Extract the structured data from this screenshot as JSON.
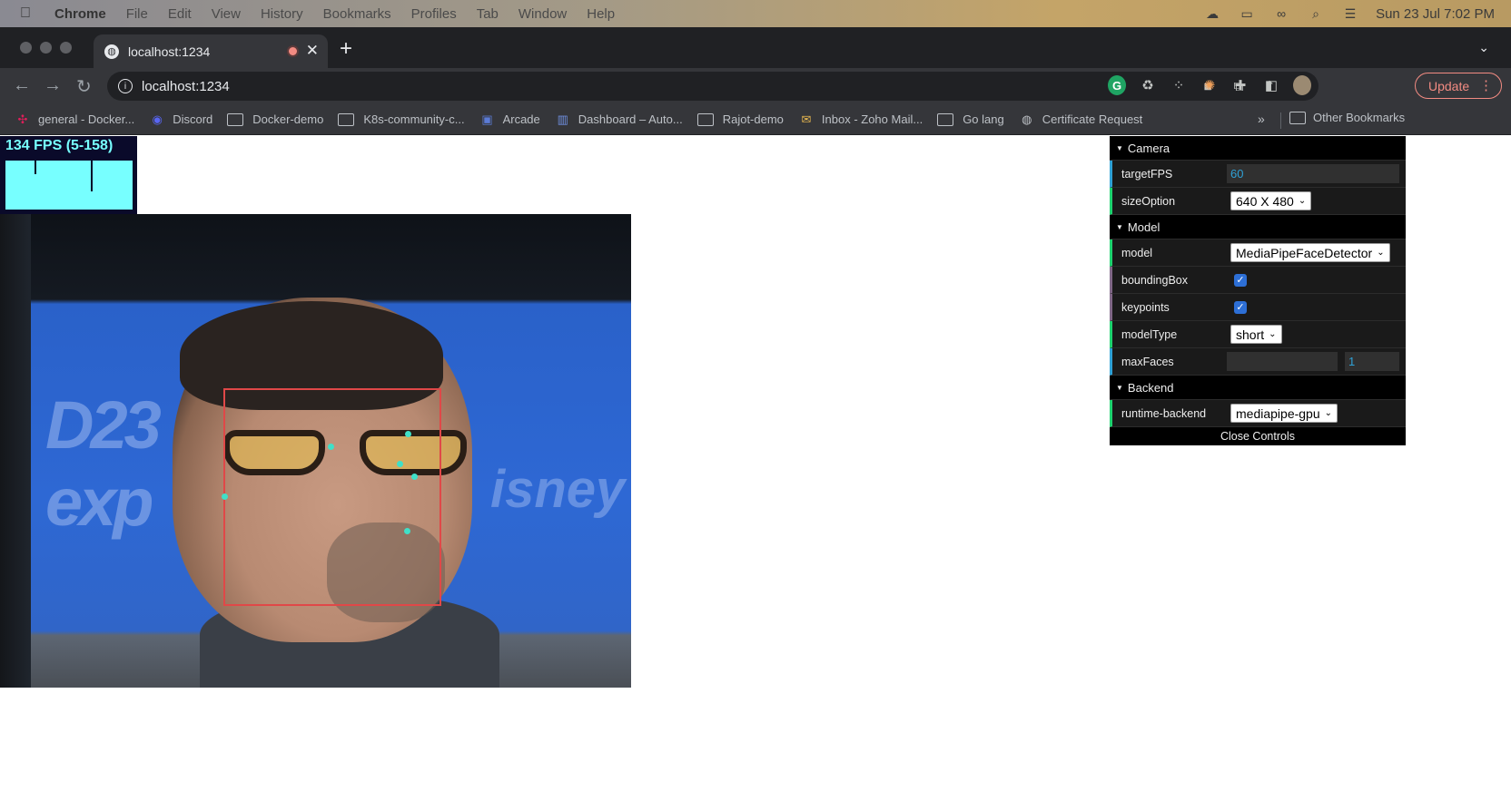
{
  "menubar": {
    "apple": "",
    "items": [
      "Chrome",
      "File",
      "Edit",
      "View",
      "History",
      "Bookmarks",
      "Profiles",
      "Tab",
      "Window",
      "Help"
    ],
    "datetime": "Sun 23 Jul  7:02 PM"
  },
  "tab": {
    "title": "localhost:1234"
  },
  "toolbar": {
    "url": "localhost:1234",
    "update_label": "Update"
  },
  "bookmarks": {
    "items": [
      "general - Docker...",
      "Discord",
      "Docker-demo",
      "K8s-community-c...",
      "Arcade",
      "Dashboard – Auto...",
      "Rajot-demo",
      "Inbox - Zoho Mail...",
      "Go lang",
      "Certificate Request"
    ],
    "overflow": "»",
    "other": "Other Bookmarks"
  },
  "stats": {
    "fps_text": "134 FPS (5-158)"
  },
  "controls": {
    "camera": {
      "title": "Camera",
      "targetFPS_label": "targetFPS",
      "targetFPS_value": "60",
      "sizeOption_label": "sizeOption",
      "sizeOption_value": "640 X 480"
    },
    "model": {
      "title": "Model",
      "model_label": "model",
      "model_value": "MediaPipeFaceDetector",
      "boundingBox_label": "boundingBox",
      "boundingBox_checked": true,
      "keypoints_label": "keypoints",
      "keypoints_checked": true,
      "modelType_label": "modelType",
      "modelType_value": "short",
      "maxFaces_label": "maxFaces",
      "maxFaces_value": "1"
    },
    "backend": {
      "title": "Backend",
      "runtime_label": "runtime-backend",
      "runtime_value": "mediapipe-gpu"
    },
    "close_label": "Close Controls"
  },
  "colors": {
    "stats_fg": "#77ffff",
    "bbox": "#e04848",
    "keypoint": "#3fe0c8",
    "gui_number": "#2fa1d6",
    "gui_option": "#1ed36f"
  }
}
